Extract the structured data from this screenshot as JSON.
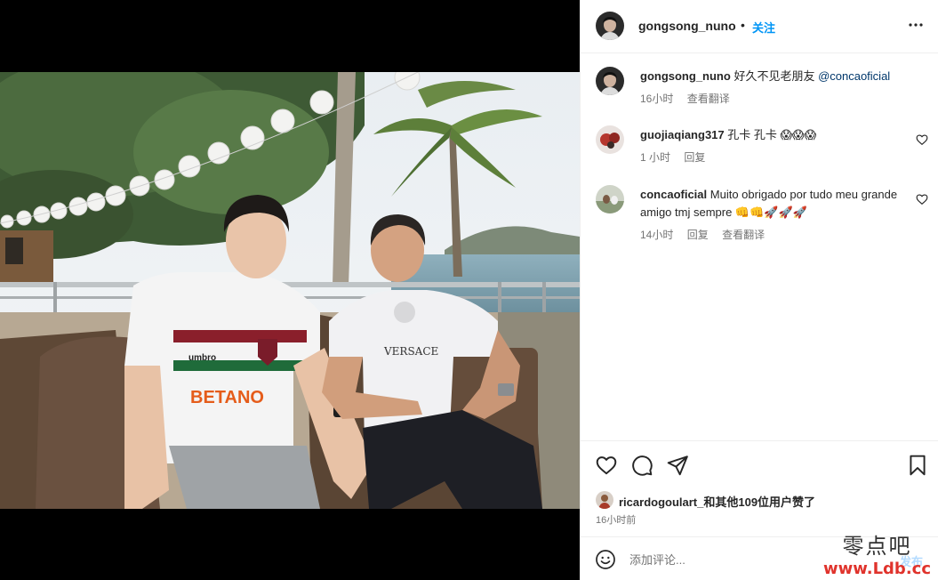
{
  "post": {
    "author": "gongsong_nuno",
    "separator": "•",
    "follow_label": "关注",
    "more_icon": "more-horizontal-icon"
  },
  "caption": {
    "author": "gongsong_nuno",
    "text": "好久不见老朋友 ",
    "mention": "@concaoficial",
    "time": "16小时",
    "translate": "查看翻译"
  },
  "comments": [
    {
      "author": "guojiaqiang317",
      "text": "孔卡 孔卡 😱😱😱",
      "time": "1 小时",
      "reply": "回复"
    },
    {
      "author": "concaoficial",
      "text": "Muito obrigado por tudo meu grande amigo tmj sempre 👊👊🚀🚀🚀",
      "time": "14小时",
      "reply": "回复",
      "translate": "查看翻译"
    }
  ],
  "actions": {
    "like_icon": "heart-icon",
    "comment_icon": "comment-icon",
    "share_icon": "send-icon",
    "save_icon": "bookmark-icon"
  },
  "likes": {
    "text": "ricardogoulart_和其他109位用户赞了"
  },
  "post_time": "16小时前",
  "add_comment": {
    "placeholder": "添加评论...",
    "post_label": "发布"
  },
  "watermark": {
    "line1": "零点吧",
    "line2": "www.Ldb.cc"
  },
  "photo": {
    "jersey_brand": "umbro",
    "jersey_sponsor": "BETANO",
    "shirt_print": "VERSACE"
  }
}
